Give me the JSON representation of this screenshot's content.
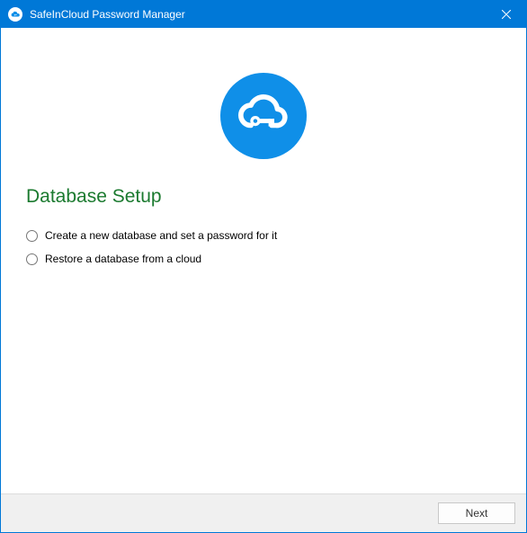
{
  "titlebar": {
    "title": "SafeInCloud Password Manager"
  },
  "main": {
    "heading": "Database Setup",
    "options": [
      {
        "label": "Create a new database and set a password for it"
      },
      {
        "label": "Restore a database from a cloud"
      }
    ]
  },
  "footer": {
    "next_label": "Next"
  },
  "colors": {
    "accent": "#0078d7",
    "logo": "#0f8fe8",
    "heading": "#1b7a2f"
  }
}
